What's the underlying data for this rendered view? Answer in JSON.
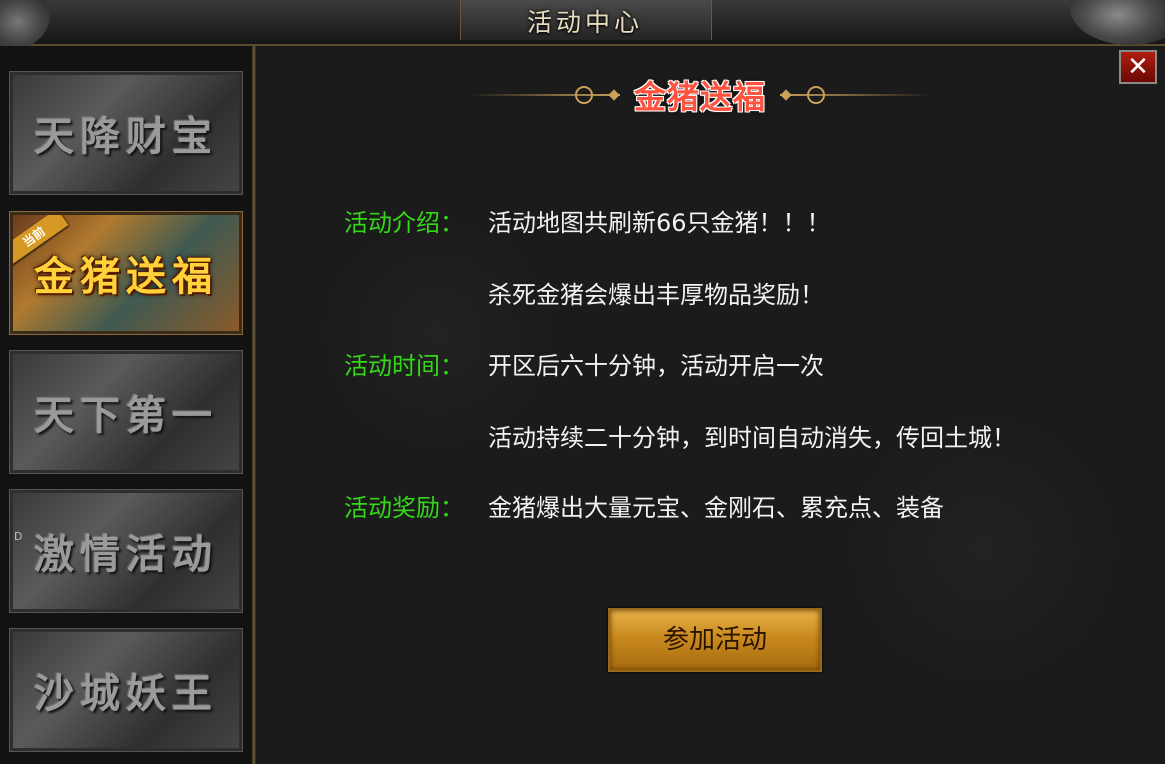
{
  "window": {
    "title": "活动中心",
    "close_icon": "✕"
  },
  "sidebar": {
    "items": [
      {
        "label": "天降财宝",
        "active": false
      },
      {
        "label": "金猪送福",
        "active": true,
        "ribbon": "当前"
      },
      {
        "label": "天下第一",
        "active": false
      },
      {
        "label": "激情活动",
        "active": false
      },
      {
        "label": "沙城妖王",
        "active": false
      }
    ],
    "mark": "D"
  },
  "main": {
    "heading": "金猪送福",
    "intro": {
      "label": "活动介绍：",
      "lines": [
        "活动地图共刷新66只金猪！！！",
        "杀死金猪会爆出丰厚物品奖励！"
      ]
    },
    "time": {
      "label": "活动时间：",
      "lines": [
        "开区后六十分钟，活动开启一次",
        "活动持续二十分钟，到时间自动消失，传回土城！"
      ]
    },
    "reward": {
      "label": "活动奖励：",
      "lines": [
        "金猪爆出大量元宝、金刚石、累充点、装备"
      ]
    },
    "join_button": "参加活动"
  },
  "colors": {
    "label_green": "#34d818",
    "heading_red": "#ff5340",
    "button_gold": "#c98a1e"
  }
}
